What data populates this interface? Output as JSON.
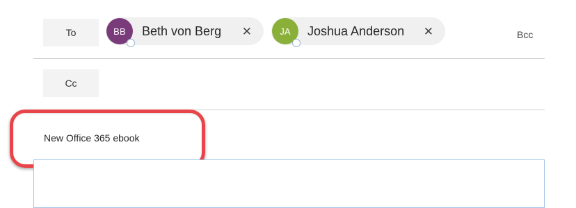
{
  "compose": {
    "to_label": "To",
    "cc_label": "Cc",
    "bcc_label": "Bcc",
    "recipients": [
      {
        "initials": "BB",
        "name": "Beth von Berg",
        "avatar_color": "#7a3b7a",
        "remove_glyph": "✕"
      },
      {
        "initials": "JA",
        "name": "Joshua Anderson",
        "avatar_color": "#8ab03a",
        "remove_glyph": "✕"
      }
    ],
    "subject": "New Office 365 ebook"
  },
  "colors": {
    "highlight": "#e8454a",
    "button_bg": "#f3f3f3",
    "pill_bg": "#f0f0f0",
    "editor_border": "#9cc3e4"
  }
}
